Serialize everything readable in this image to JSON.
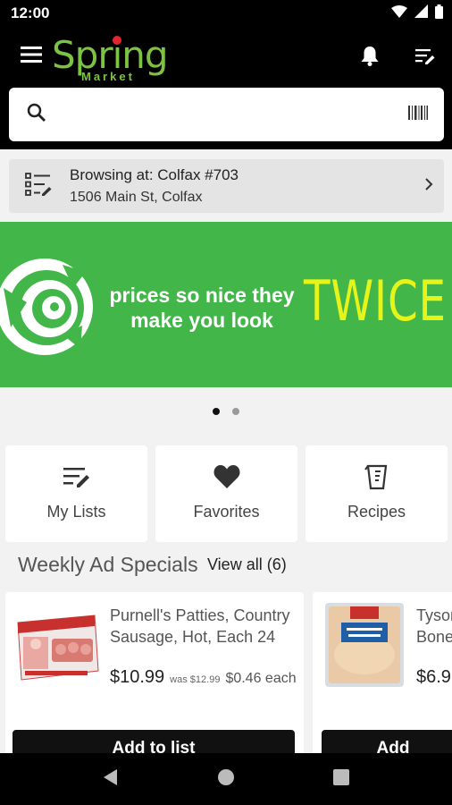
{
  "status_bar": {
    "time": "12:00",
    "icons": [
      "wifi-icon",
      "signal-icon",
      "battery-icon"
    ]
  },
  "header": {
    "logo_text": "Spring",
    "logo_sub": "Market",
    "icons": [
      "menu-icon",
      "bell-icon",
      "list-edit-icon"
    ]
  },
  "search": {
    "value": "",
    "placeholder": "",
    "icons": [
      "search-icon",
      "barcode-icon"
    ]
  },
  "store": {
    "label": "Browsing at: Colfax #703",
    "address": "1506 Main St, Colfax"
  },
  "banner": {
    "tagline": "prices so nice they make you look",
    "headline": "TWICE",
    "slide_index": 1,
    "slide_count": 2
  },
  "quick_links": [
    {
      "label": "My Lists",
      "icon": "list-edit-icon"
    },
    {
      "label": "Favorites",
      "icon": "heart-icon"
    },
    {
      "label": "Recipes",
      "icon": "measuring-cup-icon"
    }
  ],
  "weekly_ad": {
    "title": "Weekly Ad Specials",
    "view_all": "View all (6)",
    "products": [
      {
        "name": "Purnell's Patties, Country Sausage, Hot, Each 24",
        "price": "$10.99",
        "was": "was $12.99",
        "unit_price": "$0.46 each",
        "button": "Add to list"
      },
      {
        "name": "Tyson Bone",
        "price": "$6.9",
        "button": "Add"
      }
    ]
  },
  "colors": {
    "brand_green": "#7cc243",
    "banner_green": "#42b649",
    "banner_yellow": "#e7f41a",
    "logo_red": "#e0262e",
    "header_black": "#000000"
  },
  "nav_bar": {
    "icons": [
      "back-icon",
      "home-icon",
      "recents-icon"
    ]
  }
}
